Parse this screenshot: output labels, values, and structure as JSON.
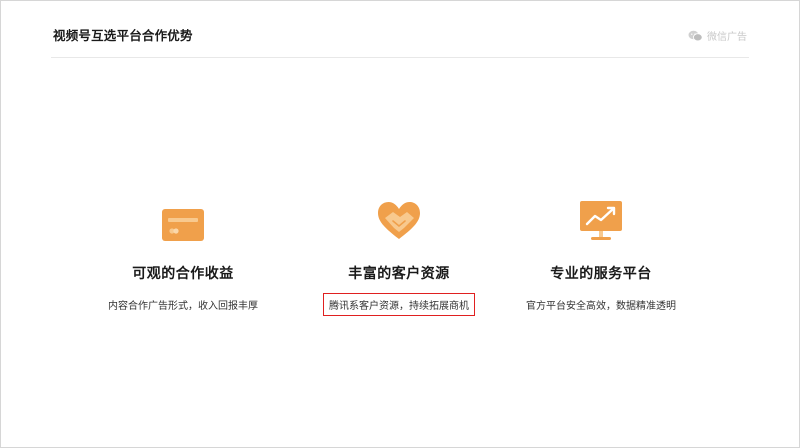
{
  "header": {
    "title": "视频号互选平台合作优势",
    "brand_label": "微信广告"
  },
  "features": [
    {
      "title": "可观的合作收益",
      "desc": "内容合作广告形式，收入回报丰厚",
      "icon": "card-icon"
    },
    {
      "title": "丰富的客户资源",
      "desc": "腾讯系客户资源，持续拓展商机",
      "icon": "heart-handshake-icon"
    },
    {
      "title": "专业的服务平台",
      "desc": "官方平台安全高效，数据精准透明",
      "icon": "monitor-chart-icon"
    }
  ],
  "colors": {
    "accent": "#F0A04B",
    "accent_light": "#F8C98E",
    "highlight_border": "#E02020"
  }
}
